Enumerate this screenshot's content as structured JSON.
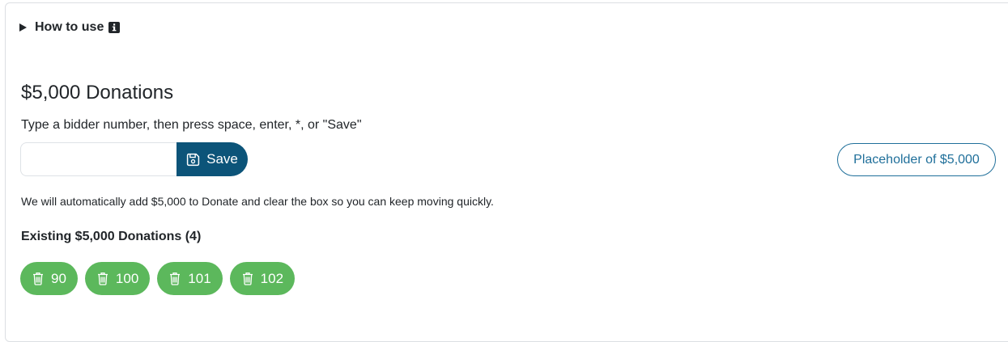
{
  "howto": {
    "label": "How to use"
  },
  "section": {
    "title": "$5,000 Donations",
    "instructions": "Type a bidder number, then press space, enter, *, or \"Save\""
  },
  "input": {
    "value": "",
    "placeholder": ""
  },
  "save_button": {
    "label": "Save"
  },
  "placeholder_button": {
    "label": "Placeholder of $5,000"
  },
  "note": "We will automatically add $5,000 to Donate and clear the box so you can keep moving quickly.",
  "existing": {
    "title": "Existing $5,000 Donations (4)",
    "chips": [
      {
        "label": "90",
        "icon": "trash-icon"
      },
      {
        "label": "100",
        "icon": "trash-icon"
      },
      {
        "label": "101",
        "icon": "trash-icon"
      },
      {
        "label": "102",
        "icon": "trash-icon"
      }
    ]
  },
  "colors": {
    "save_button": "#0c5479",
    "placeholder_button": "#1f6f9a",
    "chip": "#5cb85c"
  }
}
